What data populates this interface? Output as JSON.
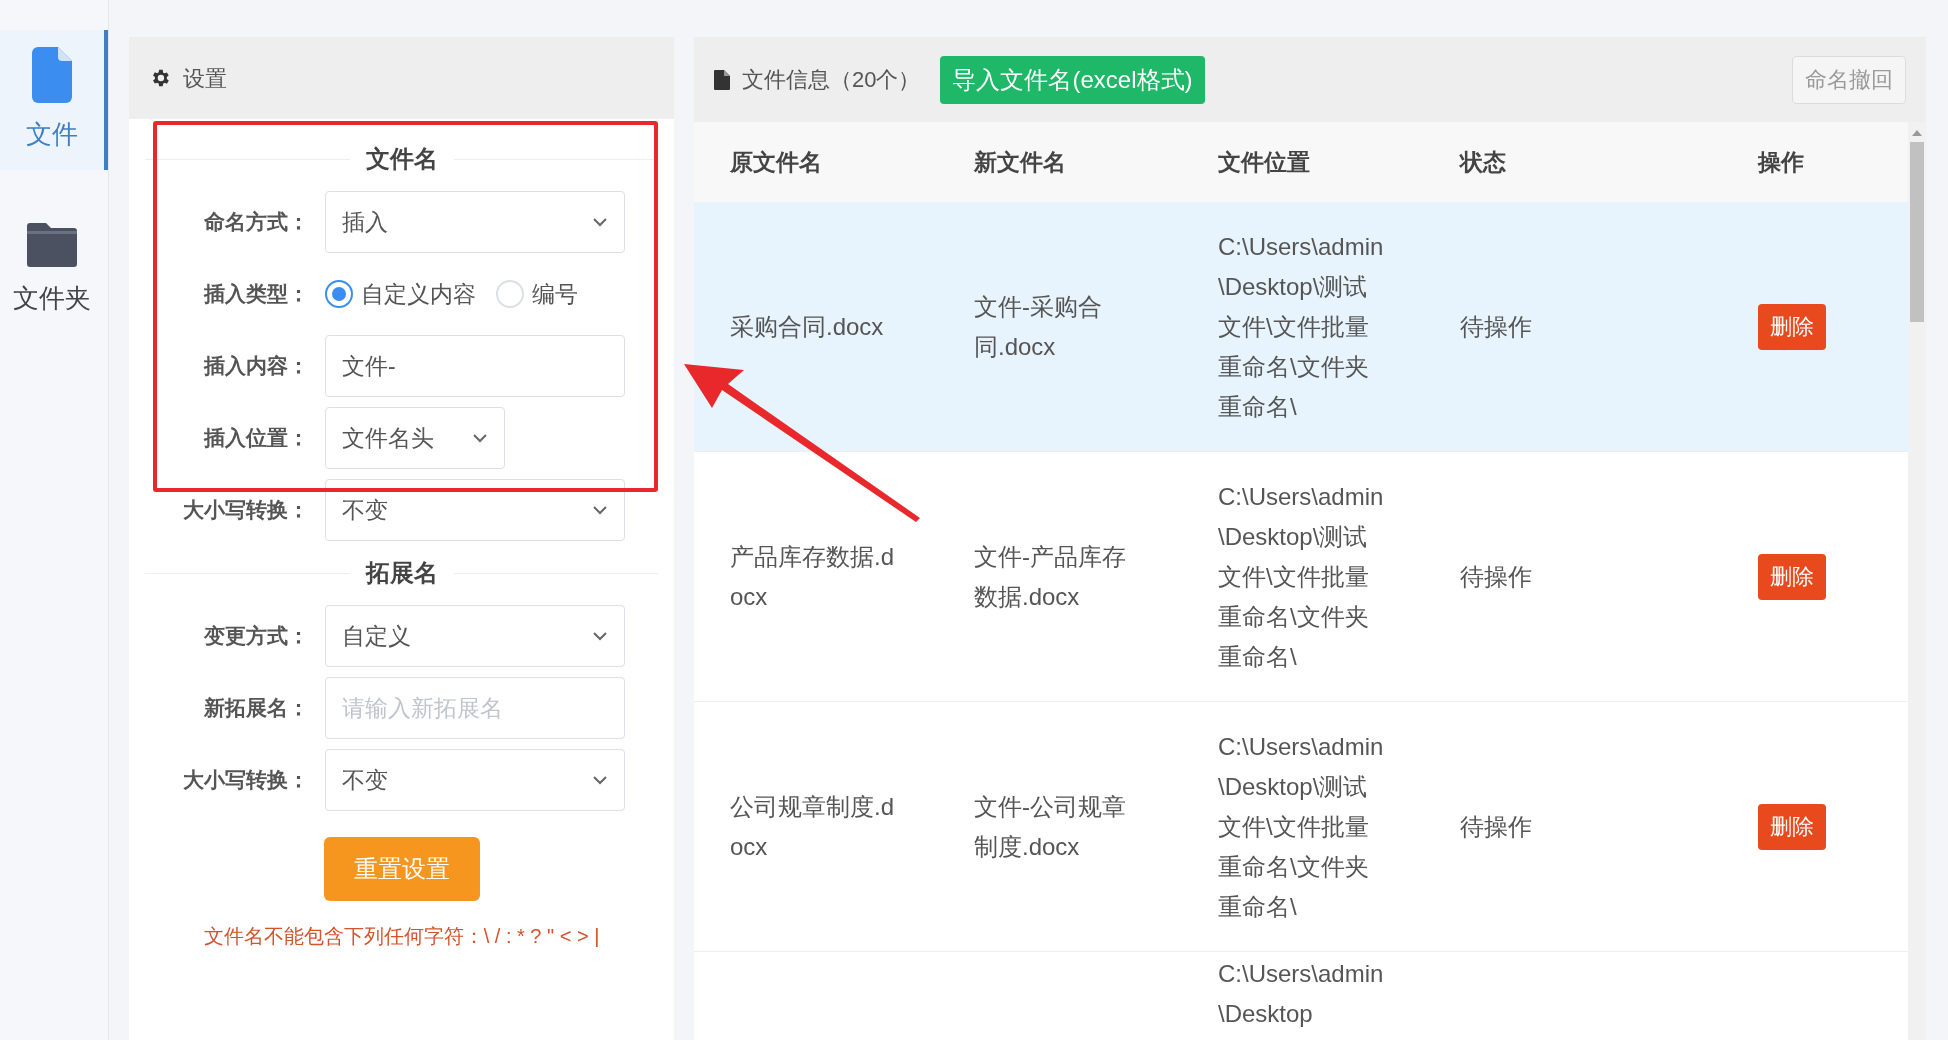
{
  "sidebar": {
    "items": [
      {
        "kind": "file",
        "label": "文件",
        "selected": true
      },
      {
        "kind": "folder",
        "label": "文件夹",
        "selected": false
      }
    ]
  },
  "settings": {
    "title": "设置",
    "sections": [
      {
        "heading": "文件名",
        "fields": [
          {
            "kind": "select",
            "label": "命名方式：",
            "value": "插入"
          },
          {
            "kind": "radio",
            "label": "插入类型：",
            "options": [
              {
                "label": "自定义内容",
                "selected": true
              },
              {
                "label": "编号",
                "selected": false
              }
            ]
          },
          {
            "kind": "input",
            "label": "插入内容：",
            "value": "文件-"
          },
          {
            "kind": "short-select",
            "label": "插入位置：",
            "value": "文件名头"
          },
          {
            "kind": "select",
            "label": "大小写转换：",
            "value": "不变"
          }
        ]
      },
      {
        "heading": "拓展名",
        "fields": [
          {
            "kind": "select",
            "label": "变更方式：",
            "value": "自定义"
          },
          {
            "kind": "input",
            "label": "新拓展名：",
            "placeholder": "请输入新拓展名"
          },
          {
            "kind": "select",
            "label": "大小写转换：",
            "value": "不变"
          }
        ]
      }
    ],
    "reset_button": "重置设置",
    "note": "文件名不能包含下列任何字符：\\ / : * ? \" < > |"
  },
  "files": {
    "title": "文件信息（20个）",
    "import_button": "导入文件名(excel格式)",
    "undo_button": {
      "label": "命名撤回",
      "disabled": true
    },
    "table": {
      "columns": [
        "原文件名",
        "新文件名",
        "文件位置",
        "状态",
        "操作"
      ],
      "rows": [
        {
          "original": "采购合同.docx",
          "new_name": "文件-采购合同.docx",
          "location": "C:\\Users\\admin\\Desktop\\测试文件\\文件批量重命名\\文件夹重命名\\",
          "status": "待操作",
          "action": "删除",
          "selected": true
        },
        {
          "original": "产品库存数据.docx",
          "new_name": "文件-产品库存数据.docx",
          "location": "C:\\Users\\admin\\Desktop\\测试文件\\文件批量重命名\\文件夹重命名\\",
          "status": "待操作",
          "action": "删除",
          "selected": false
        },
        {
          "original": "公司规章制度.docx",
          "new_name": "文件-公司规章制度.docx",
          "location": "C:\\Users\\admin\\Desktop\\测试文件\\文件批量重命名\\文件夹重命名\\",
          "status": "待操作",
          "action": "删除",
          "selected": false
        },
        {
          "location": "C:\\Users\\admin\\Desktop",
          "selected": false
        }
      ]
    }
  }
}
